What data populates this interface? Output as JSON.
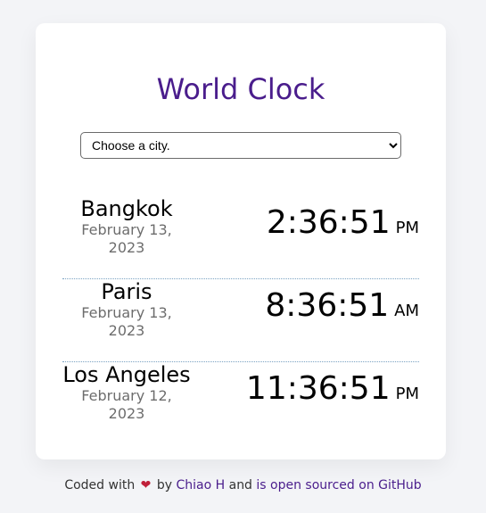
{
  "app": {
    "title": "World Clock"
  },
  "city_select": {
    "selected": "Choose a city.",
    "options": [
      "Choose a city."
    ]
  },
  "cities": [
    {
      "name": "Bangkok",
      "date": "February 13, 2023",
      "time": "2:36:51",
      "ampm": "PM"
    },
    {
      "name": "Paris",
      "date": "February 13, 2023",
      "time": "8:36:51",
      "ampm": "AM"
    },
    {
      "name": "Los Angeles",
      "date": "February 12, 2023",
      "time": "11:36:51",
      "ampm": "PM"
    }
  ],
  "footer": {
    "coded_with": "Coded with",
    "heart_icon": "❤",
    "by": "by",
    "author": "Chiao H",
    "and": "and",
    "is_open_sourced": "is open sourced on GitHub"
  },
  "colors": {
    "accent": "#4a1d8c",
    "background": "#f3f4f7",
    "card": "#ffffff",
    "date_text": "#6d6d6d",
    "divider": "#7aa2c2"
  }
}
